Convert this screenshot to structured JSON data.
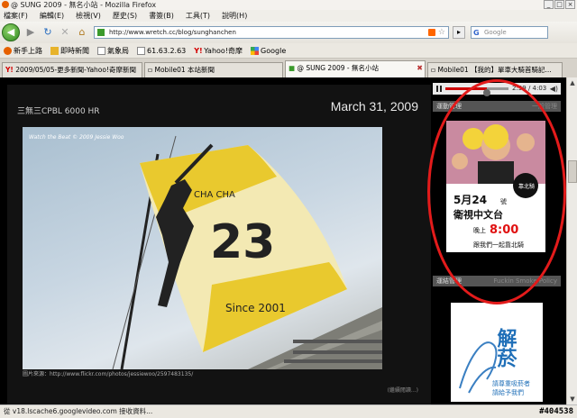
{
  "window": {
    "title": "@ SUNG 2009 - 無名小站 - Mozilla Firefox"
  },
  "menu": [
    "檔案(F)",
    "編輯(E)",
    "檢視(V)",
    "歷史(S)",
    "書簽(B)",
    "工具(T)",
    "說明(H)"
  ],
  "nav": {
    "url": "http://www.wretch.cc/blog/sunghanchen",
    "search_placeholder": "Google"
  },
  "bookmarks": [
    {
      "label": "新手上路",
      "icon": "firefox-icon",
      "color": "#e66000"
    },
    {
      "label": "即時新聞",
      "icon": "folder-icon",
      "color": "#e7b32b"
    },
    {
      "label": "氣象局",
      "icon": "page-icon",
      "color": "#888888"
    },
    {
      "label": "61.63.2.63",
      "icon": "page-icon",
      "color": "#888888"
    },
    {
      "label": "Yahoo!奇摩",
      "icon": "yahoo-icon",
      "color": "#d40000"
    },
    {
      "label": "Google",
      "icon": "google-icon",
      "color": "#3366cc"
    }
  ],
  "tabs": [
    {
      "label": "2009/05/05-更多新聞-Yahoo!奇摩新聞"
    },
    {
      "label": "Mobile01 本站新聞"
    },
    {
      "label": "@ SUNG 2009 - 無名小站",
      "active": true
    },
    {
      "label": "Mobile01 【我的】單車大騎首騎記..."
    }
  ],
  "blog": {
    "title": "三無三CPBL 6000 HR",
    "date": "March 31, 2009",
    "photo_caption": "Watch the Beat  © 2009 Jessie Woo",
    "photo_credit": "圖片來源：http://www.flickr.com/photos/jessiewoo/2597483135/",
    "read_more": "(繼續閱讀...)",
    "flag_number": "23",
    "flag_text_top": "CHA CHA",
    "flag_text_bottom": "Since 2001"
  },
  "sidebar": {
    "player_time": "2:39 / 4:03",
    "player_progress": 0.66,
    "section1": {
      "left": "運動管理",
      "right": "一般管理"
    },
    "ad1": {
      "date_num": "5月24",
      "date_suffix": "號",
      "channel": "衛視中文台",
      "time_prefix": "晚上",
      "time": "8:00",
      "tagline": "跟我們一起靠北騎",
      "badge": "靠北騎"
    },
    "section2": {
      "left": "運結管理",
      "right": "Fuckin Smoke Policy"
    },
    "ad2": {
      "title": "解菸",
      "line1": "請尊重吸菸者",
      "line2": "請給予我們"
    }
  },
  "status": {
    "text": "從 v18.lscache6.googlevideo.com 接收資料...",
    "watermark": "#404538"
  }
}
